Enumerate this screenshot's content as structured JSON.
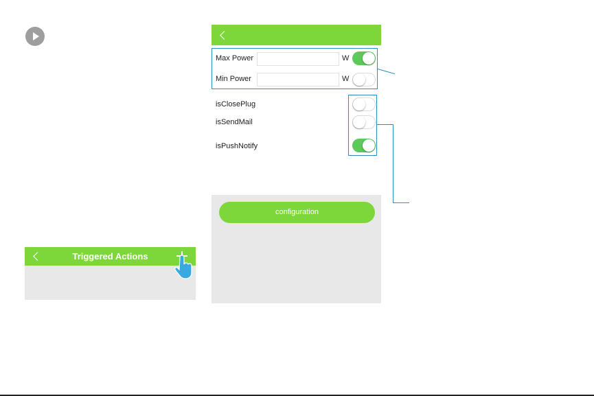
{
  "left_screen": {
    "title": "Triggered Actions"
  },
  "right_screen": {
    "fields": [
      {
        "label": "Max Power",
        "value": "",
        "unit": "W",
        "toggle": "on"
      },
      {
        "label": "Min Power",
        "value": "",
        "unit": "W",
        "toggle": "off"
      }
    ],
    "switches": [
      {
        "label": "isClosePlug",
        "toggle": "off"
      },
      {
        "label": "isSendMail",
        "toggle": "off"
      },
      {
        "label": "isPushNotify",
        "toggle": "on"
      }
    ],
    "config_button": "configuration"
  },
  "colors": {
    "accent_green": "#7dd63a",
    "toggle_on": "#5cc95a",
    "callout_blue": "#2b8fc3"
  },
  "icons": [
    "play-icon",
    "back-chevron-icon",
    "plus-icon",
    "pointing-hand-icon"
  ]
}
